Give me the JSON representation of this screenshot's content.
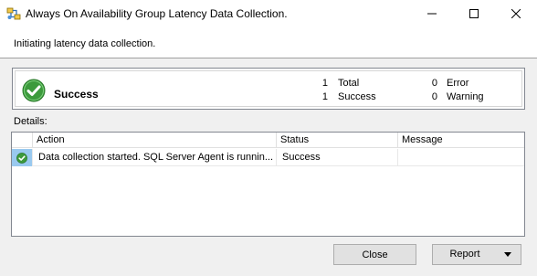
{
  "window": {
    "title": "Always On Availability Group Latency Data Collection."
  },
  "header": {
    "message": "Initiating latency data collection."
  },
  "summary": {
    "status": "Success",
    "total_count": "1",
    "total_label": "Total",
    "success_count": "1",
    "success_label": "Success",
    "error_count": "0",
    "error_label": "Error",
    "warning_count": "0",
    "warning_label": "Warning"
  },
  "details": {
    "label": "Details:",
    "columns": [
      "Action",
      "Status",
      "Message"
    ],
    "rows": [
      {
        "action": "Data collection started. SQL Server Agent is runnin...",
        "status": "Success",
        "message": ""
      }
    ]
  },
  "buttons": {
    "close": "Close",
    "report": "Report"
  },
  "colors": {
    "success_green": "#3c9a3c",
    "selection_blue": "#99c9ef"
  }
}
